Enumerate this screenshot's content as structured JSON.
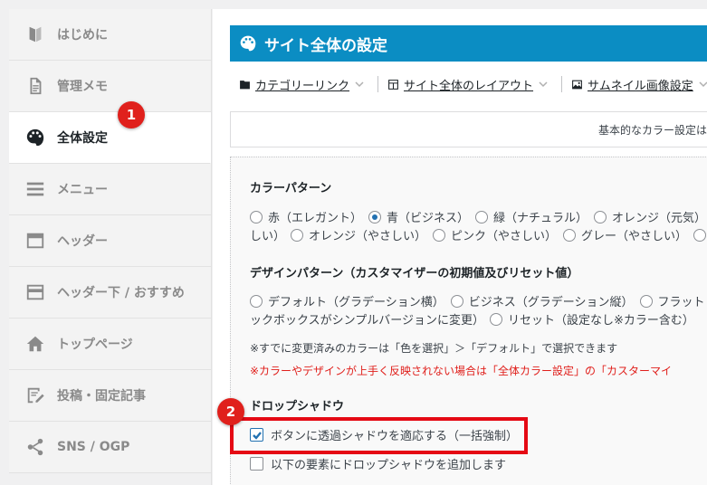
{
  "sidebar": {
    "items": [
      {
        "label": "はじめに",
        "icon": "leaf-icon"
      },
      {
        "label": "管理メモ",
        "icon": "document-icon"
      },
      {
        "label": "全体設定",
        "icon": "palette-icon"
      },
      {
        "label": "メニュー",
        "icon": "menu-icon"
      },
      {
        "label": "ヘッダー",
        "icon": "header-icon"
      },
      {
        "label": "ヘッダー下 / おすすめ",
        "icon": "header-below-icon"
      },
      {
        "label": "トップページ",
        "icon": "home-icon"
      },
      {
        "label": "投稿・固定記事",
        "icon": "edit-icon"
      },
      {
        "label": "SNS / OGP",
        "icon": "share-icon"
      }
    ],
    "active_index": 2
  },
  "badges": {
    "one": "1",
    "two": "2"
  },
  "main": {
    "title": "サイト全体の設定",
    "tabs": [
      {
        "label": "カテゴリーリンク",
        "icon": "folder-icon"
      },
      {
        "label": "サイト全体のレイアウト",
        "icon": "layout-icon"
      },
      {
        "label": "サムネイル画像設定",
        "icon": "image-icon"
      }
    ],
    "info_text": "基本的なカラー設定は「",
    "color_pattern": {
      "title": "カラーパターン",
      "row1": [
        "赤（エレガント）",
        "青（ビジネス）",
        "緑（ナチュラル）",
        "オレンジ（元気）"
      ],
      "row2_prefix": "しい）",
      "row2": [
        "オレンジ（やさしい）",
        "ピンク（やさしい）",
        "グレー（やさしい）"
      ],
      "selected": "青（ビジネス）"
    },
    "design_pattern": {
      "title": "デザインパターン（カスタマイザーの初期値及びリセット値）",
      "row1": [
        "デフォルト（グラデーション横）",
        "ビジネス（グラデーション縦）",
        "フラット"
      ],
      "row2_prefix": "ックボックスがシンプルバージョンに変更）",
      "row2": [
        "リセット（設定なし※カラー含む）"
      ]
    },
    "note1": "※すでに変更済みのカラーは「色を選択」＞「デフォルト」で選択できます",
    "note2": "※カラーやデザインが上手く反映されない場合は「全体カラー設定」の「カスターマイ",
    "drop_shadow": {
      "title": "ドロップシャドウ",
      "option1": "ボタンに透過シャドウを適応する（一括強制）",
      "option1_checked": true,
      "option2": "以下の要素にドロップシャドウを追加します",
      "option2_checked": false
    }
  },
  "colors": {
    "accent": "#0b8dc3",
    "badge": "#e0201c",
    "highlight": "#e50914",
    "warning": "#e0201c"
  }
}
